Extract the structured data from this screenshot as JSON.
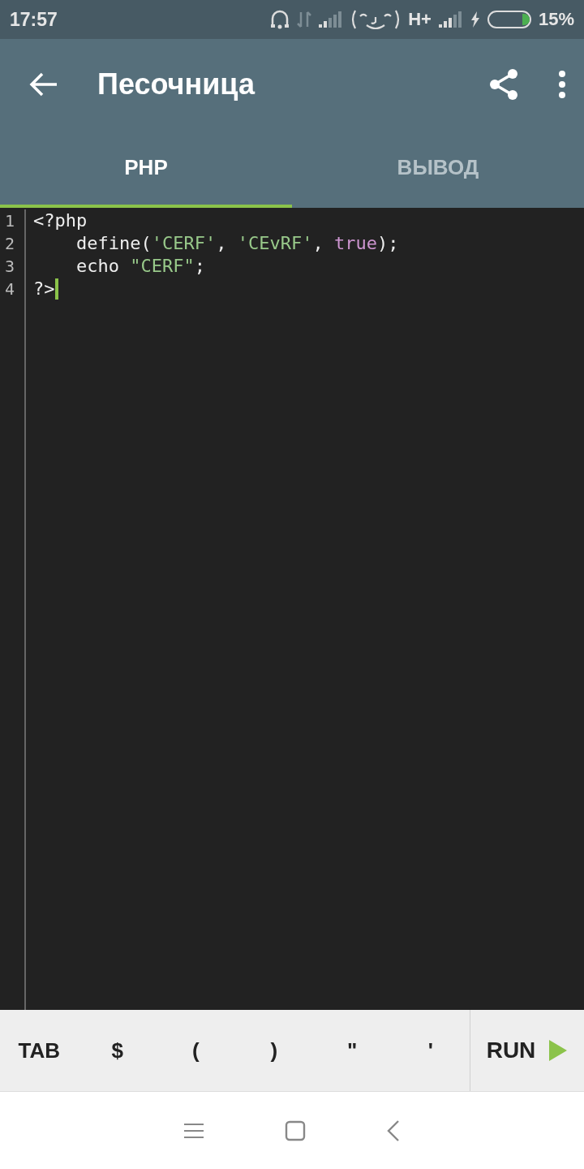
{
  "status_bar": {
    "time": "17:57",
    "network": "H+",
    "battery": "15%"
  },
  "app_bar": {
    "title": "Песочница"
  },
  "tabs": [
    {
      "label": "PHP",
      "selected": true
    },
    {
      "label": "ВЫВОД",
      "selected": false
    }
  ],
  "editor": {
    "lines": [
      {
        "number": "1",
        "cursor": false,
        "tokens": [
          {
            "text": "<?php",
            "kind": "plain"
          }
        ]
      },
      {
        "number": "2",
        "cursor": false,
        "tokens": [
          {
            "text": "    define(",
            "kind": "plain"
          },
          {
            "text": "'CERF'",
            "kind": "string"
          },
          {
            "text": ", ",
            "kind": "plain"
          },
          {
            "text": "'CEvRF'",
            "kind": "string"
          },
          {
            "text": ", ",
            "kind": "plain"
          },
          {
            "text": "true",
            "kind": "keyword"
          },
          {
            "text": ");",
            "kind": "plain"
          }
        ]
      },
      {
        "number": "3",
        "cursor": false,
        "tokens": [
          {
            "text": "    echo ",
            "kind": "plain"
          },
          {
            "text": "\"CERF\"",
            "kind": "string"
          },
          {
            "text": ";",
            "kind": "plain"
          }
        ]
      },
      {
        "number": "4",
        "cursor": true,
        "tokens": [
          {
            "text": "?>",
            "kind": "plain"
          }
        ]
      }
    ]
  },
  "keys": [
    "TAB",
    "$",
    "(",
    ")",
    "\"",
    "'"
  ],
  "run_button": {
    "label": "RUN"
  }
}
